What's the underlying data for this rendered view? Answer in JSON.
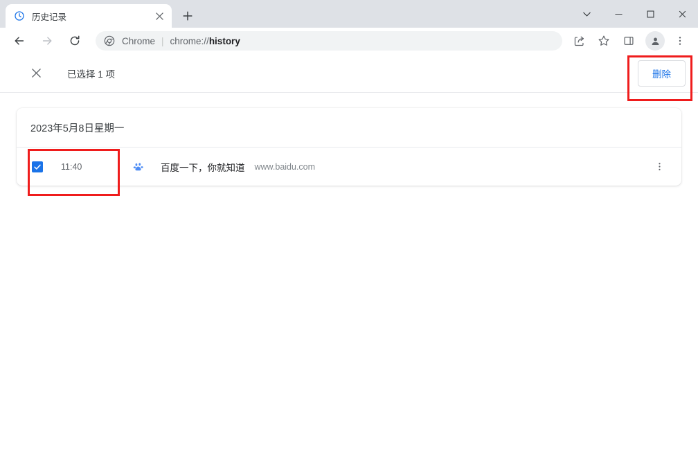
{
  "window": {
    "controls": [
      {
        "name": "tab-search-button",
        "icon": "chevron-down-icon",
        "label": ""
      },
      {
        "name": "minimize-button",
        "icon": "minimize-icon",
        "label": ""
      },
      {
        "name": "maximize-button",
        "icon": "maximize-icon",
        "label": ""
      },
      {
        "name": "close-window-button",
        "icon": "close-icon",
        "label": ""
      }
    ]
  },
  "tab_strip": {
    "tab": {
      "title": "历史记录",
      "favicon": "history-clock-icon",
      "close_tooltip": "关闭"
    },
    "new_tab_label": "+"
  },
  "toolbar": {
    "back_label": "←",
    "forward_label": "→",
    "reload_label": "⟳",
    "omnibox": {
      "chip_label": "Chrome",
      "separator": "|",
      "url_prefix": "chrome://",
      "url_bold": "history"
    },
    "actions": [
      {
        "name": "share-icon",
        "label": ""
      },
      {
        "name": "bookmark-star-icon",
        "label": ""
      },
      {
        "name": "side-panel-icon",
        "label": ""
      }
    ],
    "avatar_name": "profile-avatar",
    "menu_label": "⋮"
  },
  "history_page": {
    "selection_bar": {
      "close_label": "✕",
      "selection_text": "已选择 1 项",
      "delete_label": "删除"
    },
    "groups": [
      {
        "date": "2023年5月8日星期一",
        "entries": [
          {
            "checked": true,
            "time": "11:40",
            "favicon": "baidu-paw-icon",
            "title": "百度一下，你就知道",
            "url": "www.baidu.com",
            "more_label": "⋮"
          }
        ]
      }
    ]
  },
  "annotations": {
    "delete_highlight_color": "#ef1c1c",
    "checkbox_highlight_color": "#ef1c1c"
  }
}
